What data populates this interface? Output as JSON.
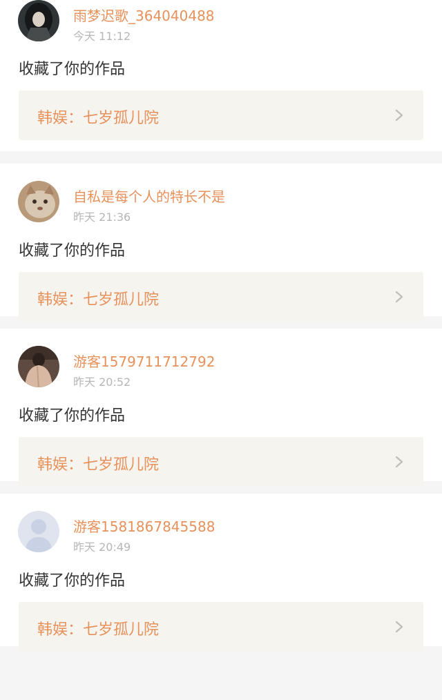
{
  "notifications": [
    {
      "username": "雨梦迟歌_364040488",
      "time": "今天 11:12",
      "action": "收藏了你的作品",
      "work_title": "韩娱：七岁孤儿院",
      "avatar": "dark-haired-girl-avatar"
    },
    {
      "username": "自私是每个人的特长不是",
      "time": "昨天 21:36",
      "action": "收藏了你的作品",
      "work_title": "韩娱：七岁孤儿院",
      "avatar": "cat-avatar"
    },
    {
      "username": "游客1579711712792",
      "time": "昨天 20:52",
      "action": "收藏了你的作品",
      "work_title": "韩娱：七岁孤儿院",
      "avatar": "person-back-avatar"
    },
    {
      "username": "游客1581867845588",
      "time": "昨天 20:49",
      "action": "收藏了你的作品",
      "work_title": "韩娱：七岁孤儿院",
      "avatar": "default-user-avatar"
    }
  ],
  "colors": {
    "accent": "#e7915b",
    "meta_text": "#b6b6b6",
    "card_link_bg": "#f6f4ee",
    "separator": "#f5f5f5"
  },
  "icons": {
    "chevron": "chevron-right-icon"
  }
}
